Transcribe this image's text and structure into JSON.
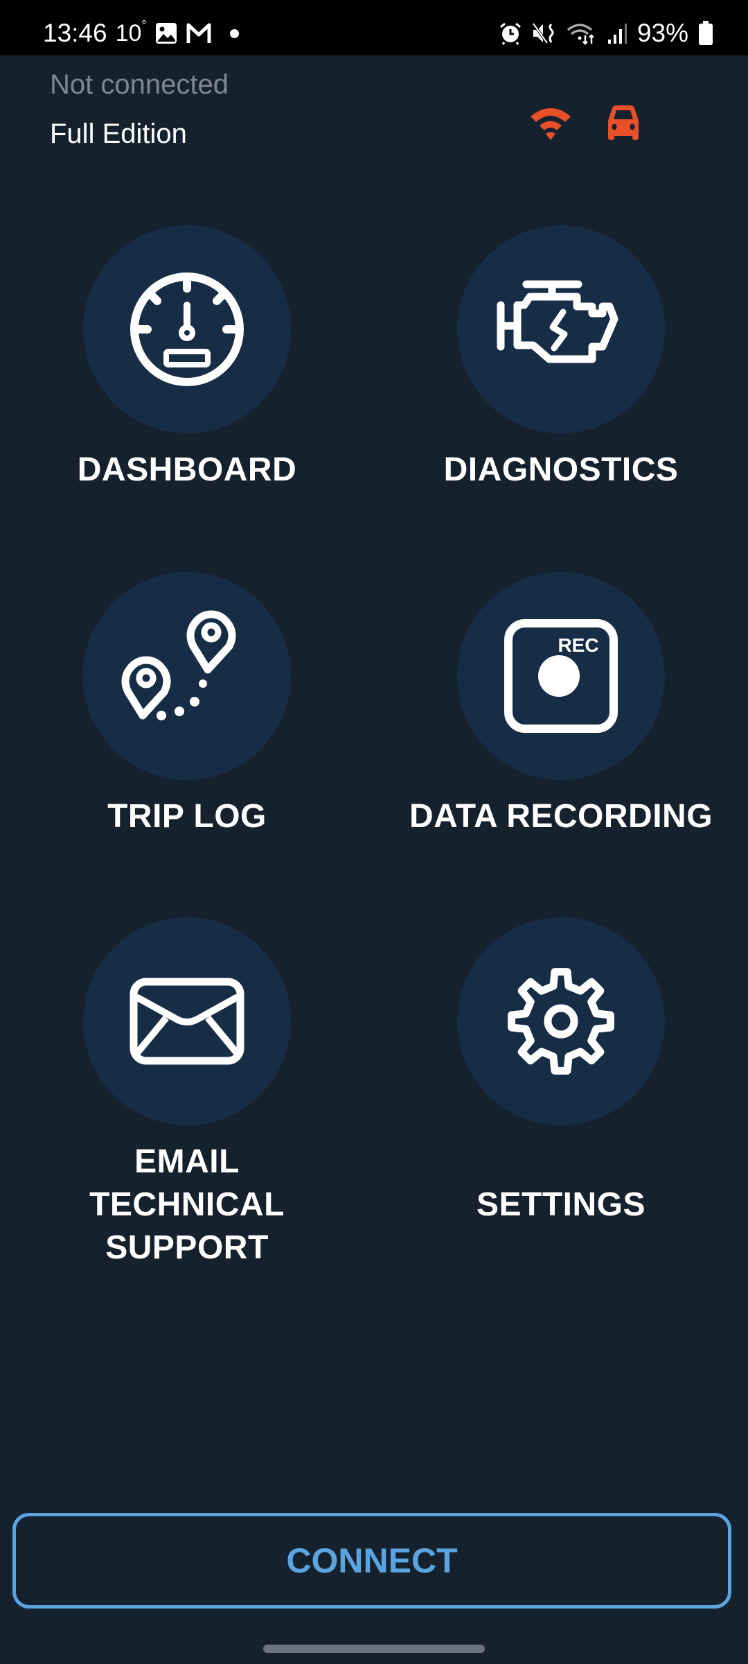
{
  "status_bar": {
    "time": "13:46",
    "temperature": "10",
    "temperature_unit": "°",
    "battery": "93%",
    "left_icons": [
      "gallery-icon",
      "gmail-icon",
      "notification-dot"
    ],
    "right_icons": [
      "alarm-icon",
      "mute-vibrate-icon",
      "wifi-data-icon",
      "signal-icon",
      "battery-icon"
    ]
  },
  "header": {
    "connection_status": "Not connected",
    "edition": "Full Edition",
    "status_icons": [
      {
        "name": "wifi-adapter-icon",
        "color": "#e8502a"
      },
      {
        "name": "car-icon",
        "color": "#e8502a"
      }
    ]
  },
  "menu": {
    "items": [
      {
        "id": "dashboard",
        "label": "DASHBOARD",
        "icon": "speedometer-icon"
      },
      {
        "id": "diagnostics",
        "label": "DIAGNOSTICS",
        "icon": "engine-icon"
      },
      {
        "id": "trip-log",
        "label": "TRIP LOG",
        "icon": "route-pins-icon"
      },
      {
        "id": "data-recording",
        "label": "DATA RECORDING",
        "icon": "record-icon",
        "icon_text": "REC"
      },
      {
        "id": "email-support",
        "label_lines": [
          "EMAIL",
          "TECHNICAL",
          "SUPPORT"
        ],
        "icon": "envelope-icon"
      },
      {
        "id": "settings",
        "label": "SETTINGS",
        "icon": "gear-icon"
      }
    ]
  },
  "footer": {
    "connect_label": "CONNECT"
  },
  "colors": {
    "background": "#16212e",
    "tile_circle": "#172d45",
    "accent": "#5aa5e0",
    "alert": "#e8502a",
    "muted_text": "#7d8894"
  }
}
